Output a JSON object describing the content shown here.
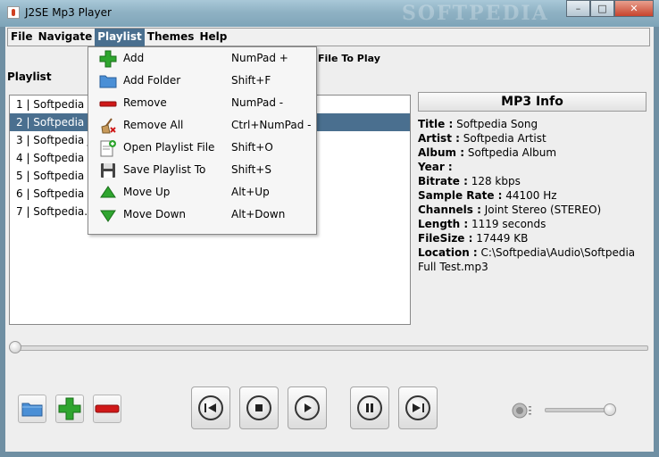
{
  "window": {
    "title": "J2SE Mp3 Player",
    "watermark": "SOFTPEDIA",
    "minimize": "–",
    "maximize": "□",
    "close": "✕"
  },
  "menubar": {
    "items": [
      "File",
      "Navigate",
      "Playlist",
      "Themes",
      "Help"
    ],
    "active": "Playlist"
  },
  "playlist_menu": {
    "items": [
      {
        "label": "Add",
        "shortcut": "NumPad +",
        "icon": "add-icon"
      },
      {
        "label": "Add Folder",
        "shortcut": "Shift+F",
        "icon": "folder-icon"
      },
      {
        "label": "Remove",
        "shortcut": "NumPad -",
        "icon": "remove-icon"
      },
      {
        "label": "Remove All",
        "shortcut": "Ctrl+NumPad -",
        "icon": "broom-icon"
      },
      {
        "label": "Open Playlist File",
        "shortcut": "Shift+O",
        "icon": "open-file-icon"
      },
      {
        "label": "Save Playlist To",
        "shortcut": "Shift+S",
        "icon": "save-icon"
      },
      {
        "label": "Move Up",
        "shortcut": "Alt+Up",
        "icon": "arrow-up-icon"
      },
      {
        "label": "Move Down",
        "shortcut": "Alt+Down",
        "icon": "arrow-down-icon"
      }
    ]
  },
  "playlist": {
    "label": "Playlist",
    "file_to_play": "File To Play",
    "selected_index": 1,
    "rows": [
      "1 | Softpedia Au",
      "2 | Softpedia Fu",
      "3 | Softpedia Jo",
      "4 | Softpedia R",
      "5 | Softpedia te",
      "6 | Softpedia Te",
      "7 | Softpedia.m"
    ]
  },
  "mp3_info": {
    "header": "MP3 Info",
    "fields": [
      {
        "key": "Title :",
        "value": " Softpedia Song"
      },
      {
        "key": "Artist :",
        "value": " Softpedia Artist"
      },
      {
        "key": "Album :",
        "value": " Softpedia Album"
      },
      {
        "key": "Year :",
        "value": ""
      },
      {
        "key": "Bitrate :",
        "value": " 128 kbps"
      },
      {
        "key": "Sample Rate :",
        "value": " 44100 Hz"
      },
      {
        "key": "Channels :",
        "value": " Joint Stereo (STEREO)"
      },
      {
        "key": "Length :",
        "value": " 1119 seconds"
      },
      {
        "key": "FileSize :",
        "value": " 17449 KB"
      },
      {
        "key": "Location :",
        "value": " C:\\Softpedia\\Audio\\Softpedia Full Test.mp3"
      }
    ]
  },
  "seek": {
    "position_fraction": 0.0
  },
  "volume": {
    "level_fraction": 0.92
  },
  "colors": {
    "selection": "#4a6f8f",
    "add_green": "#2fa52f",
    "remove_red": "#d01818",
    "folder_blue": "#4a8fd6"
  }
}
